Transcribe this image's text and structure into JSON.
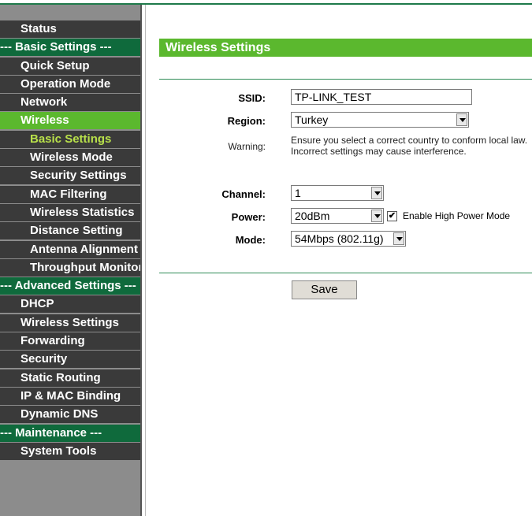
{
  "sidebar": {
    "items": [
      {
        "label": "Status",
        "level": 1,
        "type": "item"
      },
      {
        "label": "--- Basic Settings ---",
        "level": 0,
        "type": "header"
      },
      {
        "label": "Quick Setup",
        "level": 1,
        "type": "item"
      },
      {
        "label": "Operation Mode",
        "level": 1,
        "type": "item"
      },
      {
        "label": "Network",
        "level": 1,
        "type": "item"
      },
      {
        "label": "Wireless",
        "level": 1,
        "type": "active"
      },
      {
        "label": "Basic Settings",
        "level": 2,
        "type": "sub-active"
      },
      {
        "label": "Wireless Mode",
        "level": 2,
        "type": "item"
      },
      {
        "label": "Security Settings",
        "level": 2,
        "type": "item"
      },
      {
        "label": "MAC Filtering",
        "level": 2,
        "type": "item"
      },
      {
        "label": "Wireless Statistics",
        "level": 2,
        "type": "item"
      },
      {
        "label": "Distance Setting",
        "level": 2,
        "type": "item"
      },
      {
        "label": "Antenna Alignment",
        "level": 2,
        "type": "item"
      },
      {
        "label": "Throughput Monitor",
        "level": 2,
        "type": "item"
      },
      {
        "label": "--- Advanced Settings ---",
        "level": 0,
        "type": "header"
      },
      {
        "label": "DHCP",
        "level": 1,
        "type": "item"
      },
      {
        "label": "Wireless Settings",
        "level": 1,
        "type": "item"
      },
      {
        "label": "Forwarding",
        "level": 1,
        "type": "item"
      },
      {
        "label": "Security",
        "level": 1,
        "type": "item"
      },
      {
        "label": "Static Routing",
        "level": 1,
        "type": "item"
      },
      {
        "label": "IP & MAC Binding",
        "level": 1,
        "type": "item"
      },
      {
        "label": "Dynamic DNS",
        "level": 1,
        "type": "item"
      },
      {
        "label": "--- Maintenance ---",
        "level": 0,
        "type": "header"
      },
      {
        "label": "System Tools",
        "level": 1,
        "type": "item"
      }
    ]
  },
  "main": {
    "title": "Wireless Settings",
    "ssid_label": "SSID:",
    "ssid_value": "TP-LINK_TEST",
    "region_label": "Region:",
    "region_value": "Turkey",
    "warning_label": "Warning:",
    "warning_text": "Ensure you select a correct country to conform local law. Incorrect settings may cause interference.",
    "channel_label": "Channel:",
    "channel_value": "1",
    "power_label": "Power:",
    "power_value": "20dBm",
    "high_power_checked": true,
    "high_power_check_mark": "✔",
    "high_power_label": "Enable High Power Mode",
    "mode_label": "Mode:",
    "mode_value": "54Mbps (802.11g)",
    "save_label": "Save"
  },
  "colors": {
    "accent_green": "#5bb82e",
    "header_green": "#0f6a3c",
    "nav_dark": "#3a3a3a",
    "sub_active_text": "#b8e04a"
  }
}
